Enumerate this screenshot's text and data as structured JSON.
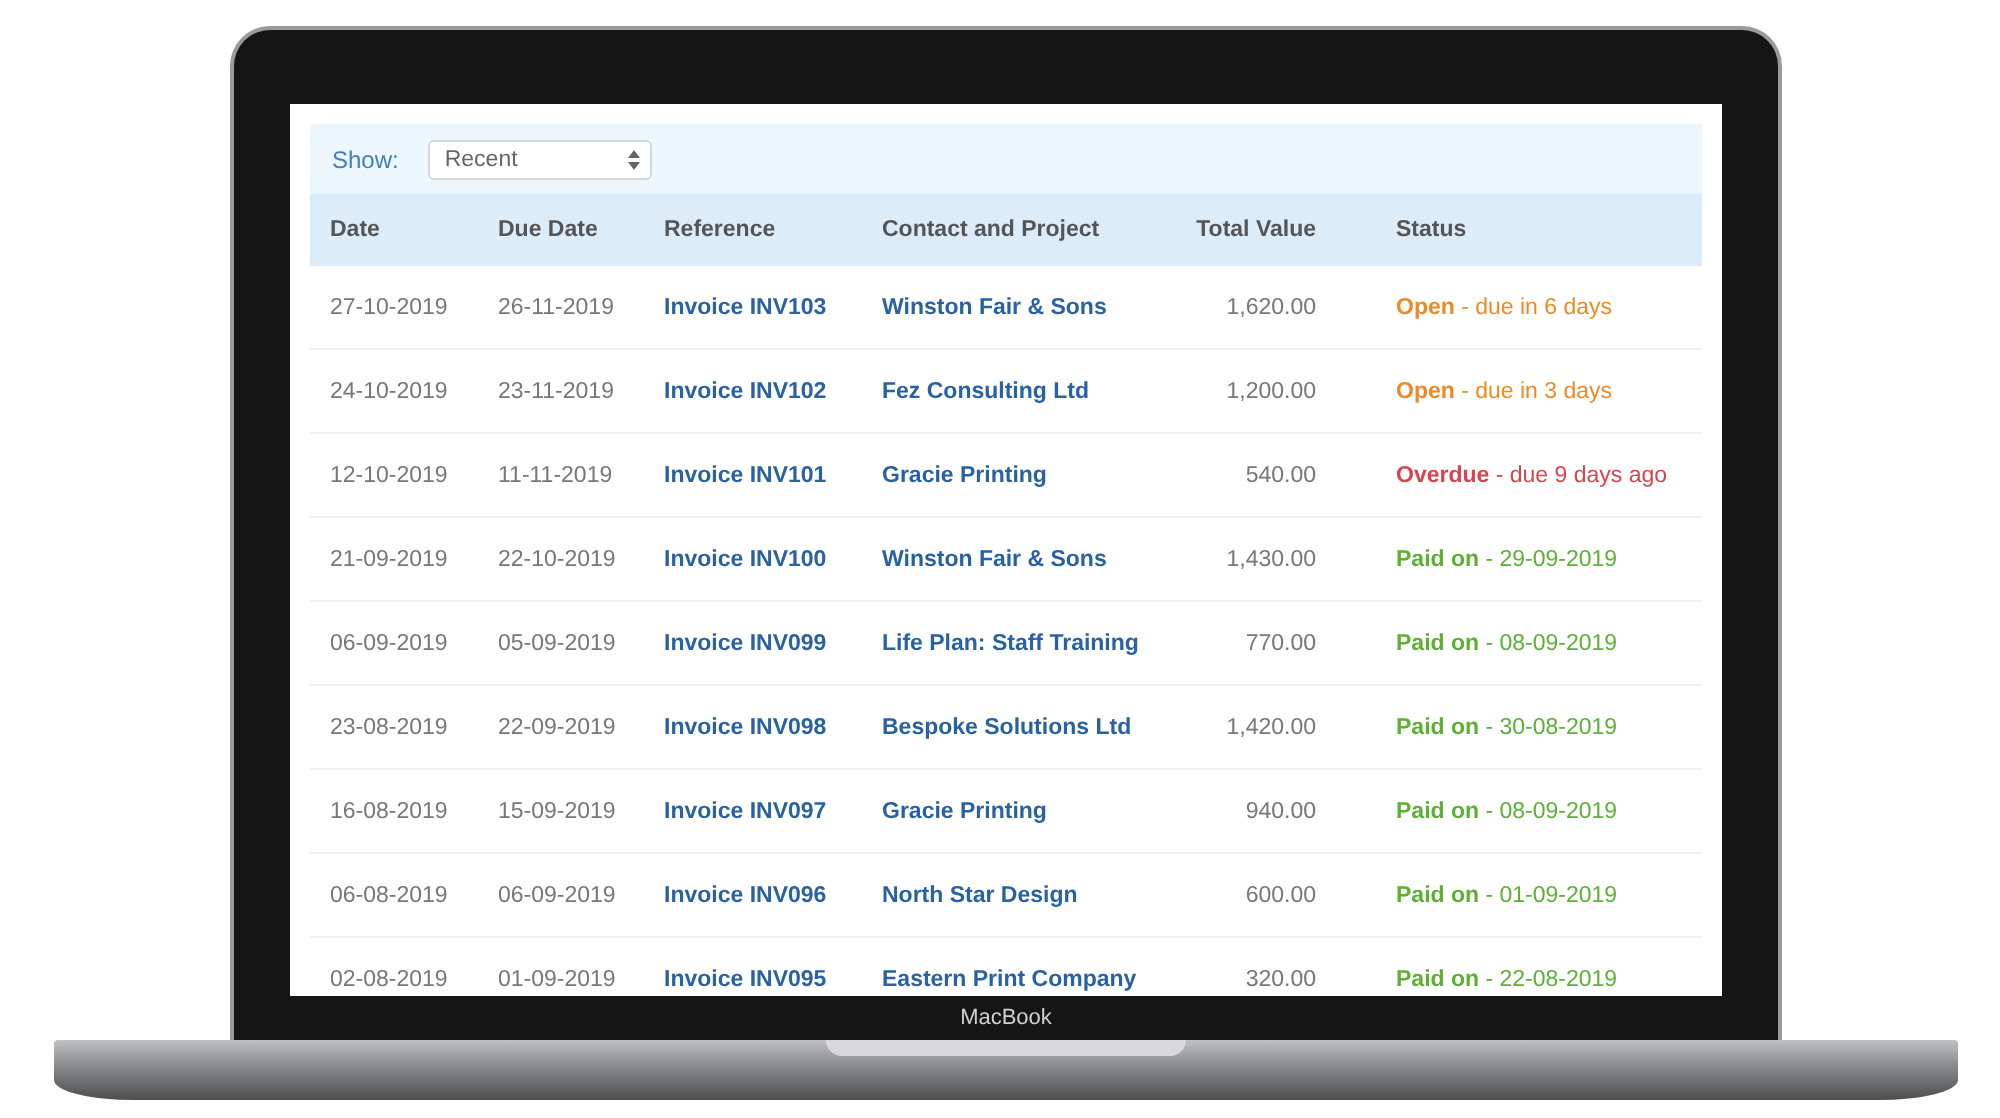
{
  "device": {
    "label": "MacBook"
  },
  "filter": {
    "label": "Show:",
    "value": "Recent"
  },
  "table": {
    "columns": [
      "Date",
      "Due Date",
      "Reference",
      "Contact and Project",
      "Total Value",
      "Status"
    ],
    "rows": [
      {
        "date": "27-10-2019",
        "due_date": "26-11-2019",
        "reference": "Invoice INV103",
        "contact": "Winston Fair & Sons",
        "total": "1,620.00",
        "status": {
          "kind": "open",
          "text": "**Open** - due in 6 days"
        }
      },
      {
        "date": "24-10-2019",
        "due_date": "23-11-2019",
        "reference": "Invoice INV102",
        "contact": "Fez Consulting Ltd",
        "total": "1,200.00",
        "status": {
          "kind": "open",
          "text": "**Open** - due in 3 days"
        }
      },
      {
        "date": "12-10-2019",
        "due_date": "11-11-2019",
        "reference": "Invoice INV101",
        "contact": "Gracie Printing",
        "total": "540.00",
        "status": {
          "kind": "overdue",
          "text": "**Overdue** - due 9 days ago"
        }
      },
      {
        "date": "21-09-2019",
        "due_date": "22-10-2019",
        "reference": "Invoice INV100",
        "contact": "Winston Fair & Sons",
        "total": "1,430.00",
        "status": {
          "kind": "paid",
          "text": "**Paid on** - 29-09-2019"
        }
      },
      {
        "date": "06-09-2019",
        "due_date": "05-09-2019",
        "reference": "Invoice INV099",
        "contact": "Life Plan: Staff Training",
        "total": "770.00",
        "status": {
          "kind": "paid",
          "text": "**Paid on** - 08-09-2019"
        }
      },
      {
        "date": "23-08-2019",
        "due_date": "22-09-2019",
        "reference": "Invoice INV098",
        "contact": "Bespoke Solutions Ltd",
        "total": "1,420.00",
        "status": {
          "kind": "paid",
          "text": "**Paid on** - 30-08-2019"
        }
      },
      {
        "date": "16-08-2019",
        "due_date": "15-09-2019",
        "reference": "Invoice INV097",
        "contact": "Gracie Printing",
        "total": "940.00",
        "status": {
          "kind": "paid",
          "text": "**Paid on** - 08-09-2019"
        }
      },
      {
        "date": "06-08-2019",
        "due_date": "06-09-2019",
        "reference": "Invoice INV096",
        "contact": "North Star Design",
        "total": "600.00",
        "status": {
          "kind": "paid",
          "text": "**Paid on** - 01-09-2019"
        }
      },
      {
        "date": "02-08-2019",
        "due_date": "01-09-2019",
        "reference": "Invoice INV095",
        "contact": "Eastern Print Company",
        "total": "320.00",
        "status": {
          "kind": "paid",
          "text": "**Paid on** - 22-08-2019"
        }
      }
    ]
  }
}
